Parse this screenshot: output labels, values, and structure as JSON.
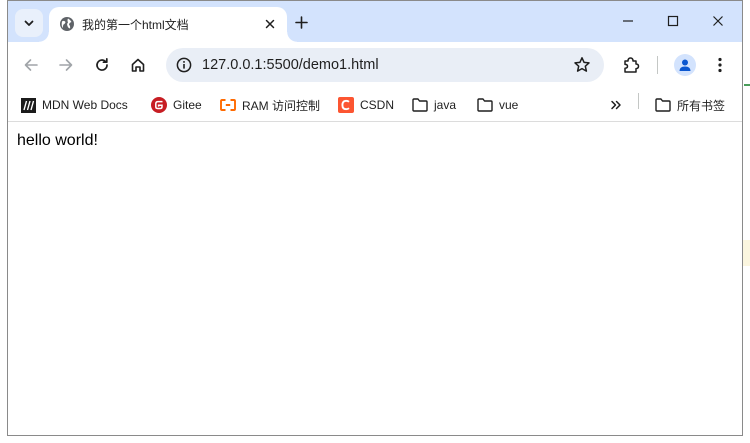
{
  "browser": {
    "tab": {
      "title": "我的第一个html文档"
    },
    "address_bar": {
      "url": "127.0.0.1:5500/demo1.html"
    },
    "bookmarks": [
      {
        "label": "MDN Web Docs",
        "icon": "mdn-icon"
      },
      {
        "label": "Gitee",
        "icon": "gitee-icon"
      },
      {
        "label": "RAM 访问控制",
        "icon": "aliyun-icon"
      },
      {
        "label": "CSDN",
        "icon": "csdn-icon"
      },
      {
        "label": "java",
        "icon": "folder-icon"
      },
      {
        "label": "vue",
        "icon": "folder-icon"
      }
    ],
    "all_bookmarks": {
      "label": "所有书签",
      "icon": "folder-icon"
    }
  },
  "page": {
    "text": "hello world!"
  },
  "colors": {
    "titlebar": "#d3e3fd",
    "omnibox": "#e9eef6",
    "gitee": "#c71d23",
    "aliyun": "#ff6a00",
    "csdn": "#fc5531"
  }
}
